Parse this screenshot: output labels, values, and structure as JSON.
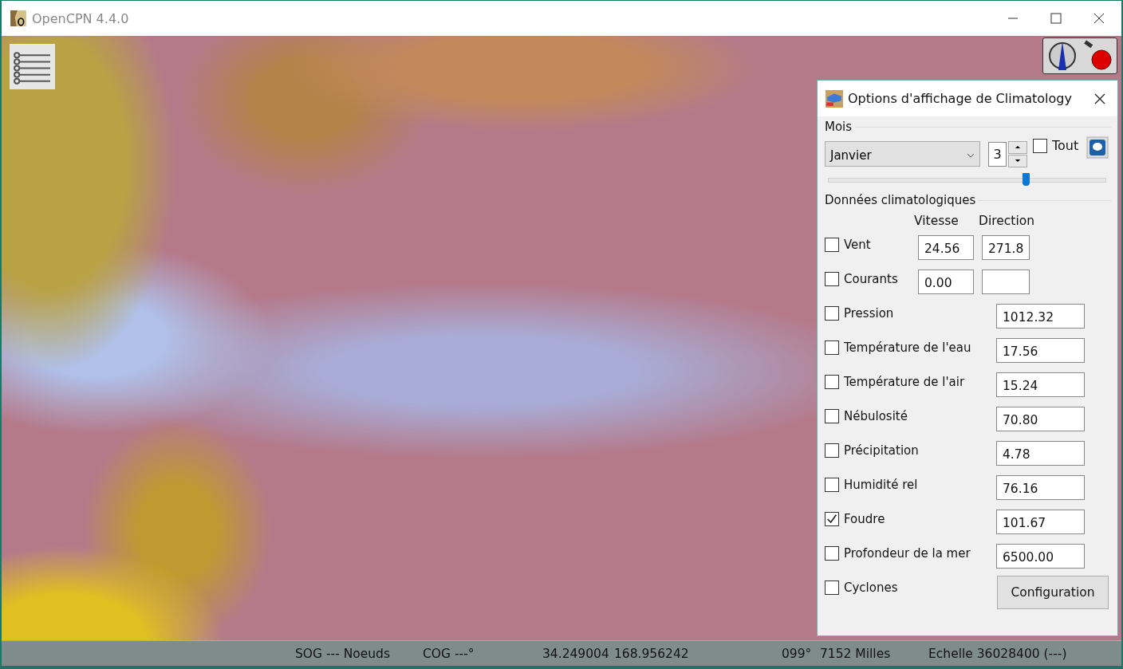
{
  "window": {
    "title": "OpenCPN 4.4.0"
  },
  "dialog": {
    "title": "Options d'affichage de Climatology",
    "month_group": {
      "label": "Mois",
      "month": "Janvier",
      "day": "3",
      "all": {
        "label": "Tout",
        "checked": false
      },
      "level": 0.71
    },
    "data_group": {
      "label": "Données climatologiques",
      "speed_header": "Vitesse",
      "direction_header": "Direction",
      "rows": [
        {
          "kind": "vector",
          "label": "Vent",
          "checked": false,
          "speed": "24.56",
          "direction": "271.8"
        },
        {
          "kind": "vector",
          "label": "Courants",
          "checked": false,
          "speed": "0.00"
        },
        {
          "kind": "scalar",
          "label": "Pression",
          "checked": false,
          "value": "1012.32"
        },
        {
          "kind": "scalar",
          "label": "Température de l'eau",
          "checked": false,
          "value": "17.56"
        },
        {
          "kind": "scalar",
          "label": "Température de l'air",
          "checked": false,
          "value": "15.24"
        },
        {
          "kind": "scalar",
          "label": "Nébulosité",
          "checked": false,
          "value": "70.80"
        },
        {
          "kind": "scalar",
          "label": "Précipitation",
          "checked": false,
          "value": "4.78"
        },
        {
          "kind": "scalar",
          "label": "Humidité rel",
          "checked": false,
          "value": "76.16"
        },
        {
          "kind": "scalar",
          "label": "Foudre",
          "checked": true,
          "value": "101.67"
        },
        {
          "kind": "scalar",
          "label": "Profondeur de la mer",
          "checked": false,
          "value": "6500.00"
        },
        {
          "kind": "button",
          "label": "Cyclones",
          "checked": false,
          "button": "Configuration"
        }
      ]
    }
  },
  "status_bar": [
    "SOG --- Noeuds",
    "COG ---°",
    "34.249004",
    "168.956242",
    "099°",
    "7152 Milles",
    "Echelle 36028400 (---)"
  ]
}
